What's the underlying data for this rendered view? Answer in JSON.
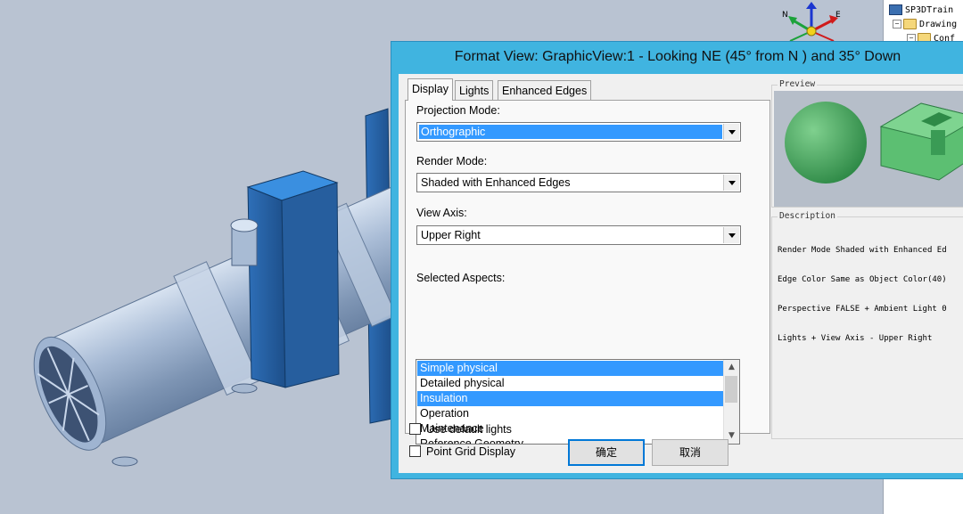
{
  "dialog": {
    "title": "Format View: GraphicView:1 - Looking NE (45° from N ) and 35° Down",
    "tabs": [
      {
        "label": "Display",
        "active": true
      },
      {
        "label": "Lights",
        "active": false
      },
      {
        "label": "Enhanced Edges",
        "active": false
      }
    ],
    "projection_mode": {
      "label": "Projection Mode:",
      "value": "Orthographic"
    },
    "render_mode": {
      "label": "Render Mode:",
      "value": "Shaded with Enhanced Edges"
    },
    "view_axis": {
      "label": "View Axis:",
      "value": "Upper Right"
    },
    "aspects": {
      "label": "Selected Aspects:",
      "items": [
        {
          "label": "Simple physical",
          "selected": true
        },
        {
          "label": "Detailed physical",
          "selected": false
        },
        {
          "label": "Insulation",
          "selected": true
        },
        {
          "label": "Operation",
          "selected": false
        },
        {
          "label": "Maintenance",
          "selected": false
        },
        {
          "label": "Reference Geometry",
          "selected": false
        }
      ]
    },
    "use_default_lights": {
      "label": "Use default lights",
      "checked": false
    },
    "point_grid_display": {
      "label": "Point Grid Display",
      "checked": false
    },
    "ok_label": "确定",
    "cancel_label": "取消",
    "preview_caption": "Preview",
    "description_caption": "Description",
    "description_lines": [
      "Render Mode Shaded with Enhanced Ed",
      "Edge Color Same as Object Color(40)",
      "Perspective FALSE + Ambient Light 0",
      "Lights + View Axis - Upper Right"
    ]
  },
  "compass": {
    "north": "N",
    "east": "E"
  },
  "tree": {
    "root": "SP3DTrain",
    "child1": "Drawing",
    "child2": "Conf"
  },
  "colors": {
    "title_bar": "#40b4e0",
    "selection": "#3399ff",
    "viewport_bg": "#b9c3d2",
    "preview_green": "#4caa62"
  }
}
